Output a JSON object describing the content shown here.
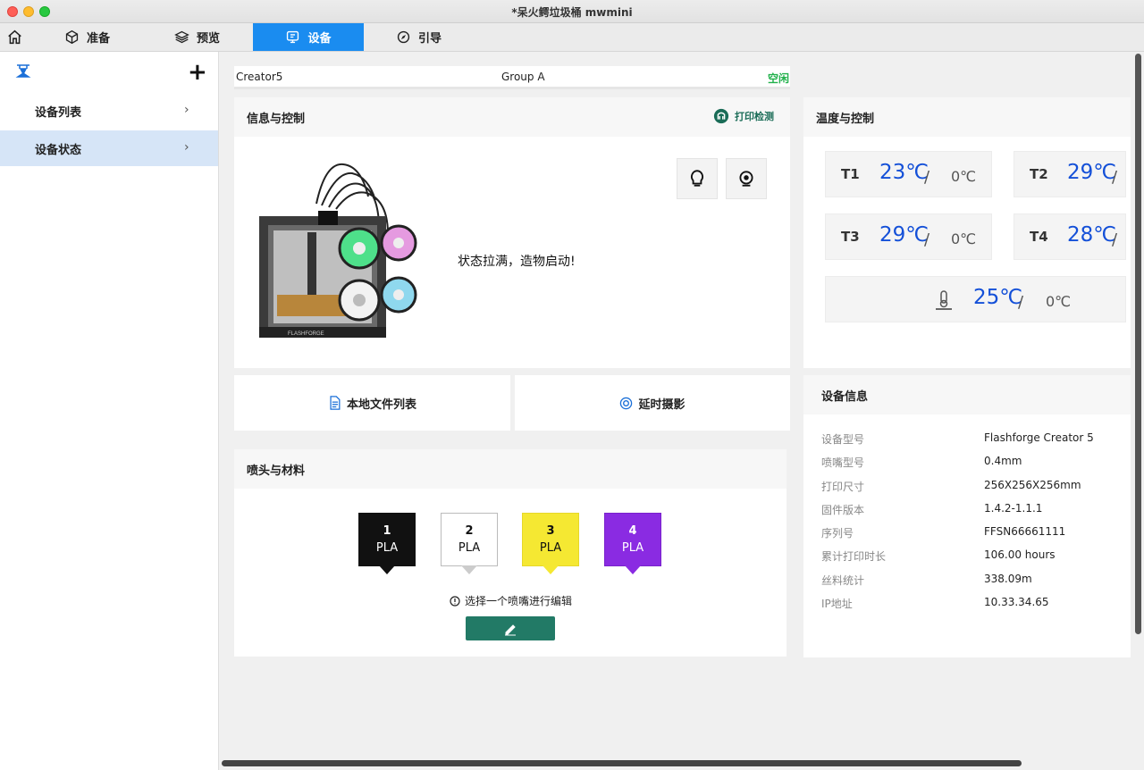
{
  "window": {
    "title": "*呆火鳄垃圾桶 mwmini"
  },
  "tabs": [
    {
      "label": "准备",
      "icon": "cube-icon"
    },
    {
      "label": "预览",
      "icon": "layers-icon"
    },
    {
      "label": "设备",
      "icon": "device-icon",
      "active": true
    },
    {
      "label": "引导",
      "icon": "compass-icon"
    }
  ],
  "sidebar": {
    "items": [
      {
        "label": "设备列表"
      },
      {
        "label": "设备状态",
        "selected": true
      }
    ]
  },
  "device_bar": {
    "name": "Creator5",
    "group": "Group A",
    "status": "空闲",
    "status_color": "#22b14c"
  },
  "info_control": {
    "title": "信息与控制",
    "print_check_label": "打印检测",
    "status_message": "状态拉满，造物启动!",
    "printer_brand": "FLASHFORGE"
  },
  "temperature": {
    "title": "温度与控制",
    "cards": [
      {
        "label": "T1",
        "current": "23℃",
        "target": "0℃"
      },
      {
        "label": "T2",
        "current": "29℃",
        "target": ""
      },
      {
        "label": "T3",
        "current": "29℃",
        "target": "0℃"
      },
      {
        "label": "T4",
        "current": "28℃",
        "target": ""
      },
      {
        "label": "",
        "current": "25℃",
        "target": "0℃",
        "icon": "bed-thermometer-icon"
      }
    ],
    "accent_color": "#1450d8"
  },
  "actions": {
    "local_files": "本地文件列表",
    "timelapse": "延时摄影"
  },
  "device_info": {
    "title": "设备信息",
    "rows": [
      {
        "key": "设备型号",
        "value": "Flashforge Creator 5"
      },
      {
        "key": "喷嘴型号",
        "value": "0.4mm"
      },
      {
        "key": "打印尺寸",
        "value": "256X256X256mm"
      },
      {
        "key": "固件版本",
        "value": "1.4.2-1.1.1"
      },
      {
        "key": "序列号",
        "value": "FFSN66661111"
      },
      {
        "key": "累计打印时长",
        "value": "106.00 hours"
      },
      {
        "key": "丝料统计",
        "value": "338.09m"
      },
      {
        "key": "IP地址",
        "value": "10.33.34.65"
      }
    ]
  },
  "nozzles": {
    "title": "喷头与材料",
    "items": [
      {
        "number": "1",
        "material": "PLA",
        "color": "#111111",
        "text_color": "#ffffff"
      },
      {
        "number": "2",
        "material": "PLA",
        "color": "#ffffff",
        "text_color": "#111111"
      },
      {
        "number": "3",
        "material": "PLA",
        "color": "#f5e832",
        "text_color": "#111111"
      },
      {
        "number": "4",
        "material": "PLA",
        "color": "#8a2be2",
        "text_color": "#ffffff"
      }
    ],
    "hint": "选择一个喷嘴进行编辑",
    "edit_color": "#227a66"
  }
}
